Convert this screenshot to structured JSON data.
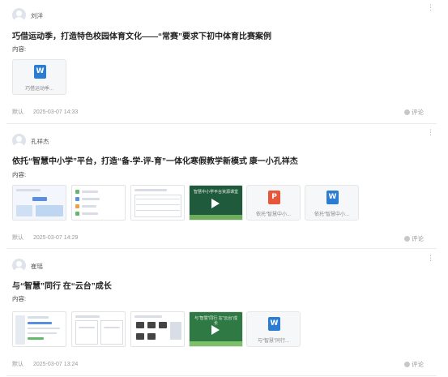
{
  "posts": [
    {
      "author": "刘洋",
      "title": "巧借运动季，打造特色校园体育文化——“常赛”要求下初中体育比赛案例",
      "content_label": "内容:",
      "attachments": [
        {
          "type": "word-file",
          "name": "巧借运动季..."
        }
      ],
      "category": "默认",
      "date": "2025-03-07 14:33",
      "comment_label": "评论"
    },
    {
      "author": "孔祥杰",
      "title": "依托“智慧中小学”平台，打造“备-学-评-育”一体化寒假教学新模式 康一小孔祥杰",
      "content_label": "内容:",
      "thumb_texts": {
        "video_caption": "智慧中小学平台资源课堂",
        "image_caption": "国家中小学智慧教育平台"
      },
      "attachments": [
        {
          "type": "image"
        },
        {
          "type": "image"
        },
        {
          "type": "image"
        },
        {
          "type": "video"
        },
        {
          "type": "ppt-file",
          "name": "依托“智慧中小..."
        },
        {
          "type": "word-file",
          "name": "依托“智慧中小..."
        }
      ],
      "category": "默认",
      "date": "2025-03-07 14:29",
      "comment_label": "评论"
    },
    {
      "author": "崔瑶",
      "title": "与“智慧”同行 在“云台”成长",
      "content_label": "内容:",
      "thumb_texts": {
        "video_caption": "与“智慧”同行 在“云台”成长"
      },
      "attachments": [
        {
          "type": "image"
        },
        {
          "type": "image"
        },
        {
          "type": "image"
        },
        {
          "type": "video"
        },
        {
          "type": "word-file",
          "name": "与“智慧”同行..."
        }
      ],
      "category": "默认",
      "date": "2025-03-07 13:24",
      "comment_label": "评论"
    }
  ],
  "icons": {
    "word_glyph": "W",
    "ppt_glyph": "P",
    "more_glyph": "⋮"
  },
  "colors": {
    "word": "#2b7cd3",
    "ppt": "#e8563a",
    "video_bg": "#1f5a3c"
  }
}
